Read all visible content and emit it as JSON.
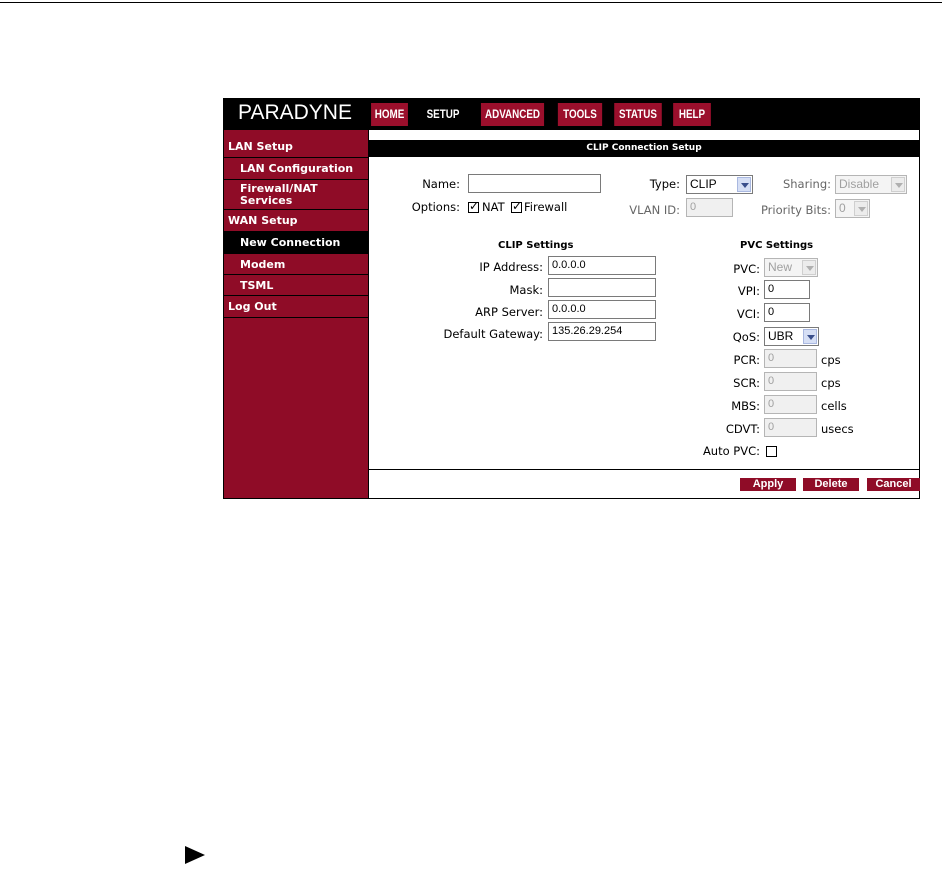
{
  "header": {
    "logo": "PARADYNE",
    "tabs": [
      "HOME",
      "SETUP",
      "ADVANCED",
      "TOOLS",
      "STATUS",
      "HELP"
    ],
    "active_tab": "SETUP"
  },
  "sidebar": {
    "items": [
      {
        "label": "LAN Setup"
      },
      {
        "label": "LAN Configuration"
      },
      {
        "label": "Firewall/NAT"
      },
      {
        "label": "Services"
      },
      {
        "label": "WAN Setup"
      },
      {
        "label": "New Connection"
      },
      {
        "label": "Modem"
      },
      {
        "label": "TSML"
      },
      {
        "label": "Log Out"
      }
    ]
  },
  "main": {
    "title": "CLIP Connection Setup",
    "name_label": "Name:",
    "name_value": "",
    "type_label": "Type:",
    "type_value": "CLIP",
    "sharing_label": "Sharing:",
    "sharing_value": "Disable",
    "options_label": "Options:",
    "nat_label": "NAT",
    "firewall_label": "Firewall",
    "vlan_label": "VLAN ID:",
    "vlan_value": "0",
    "priority_label": "Priority Bits:",
    "priority_value": "0",
    "clip": {
      "heading": "CLIP Settings",
      "ip_label": "IP Address:",
      "ip_value": "0.0.0.0",
      "mask_label": "Mask:",
      "mask_value": "",
      "arp_label": "ARP Server:",
      "arp_value": "0.0.0.0",
      "gw_label": "Default Gateway:",
      "gw_value": "135.26.29.254"
    },
    "pvc": {
      "heading": "PVC Settings",
      "pvc_label": "PVC:",
      "pvc_value": "New",
      "vpi_label": "VPI:",
      "vpi_value": "0",
      "vci_label": "VCI:",
      "vci_value": "0",
      "qos_label": "QoS:",
      "qos_value": "UBR",
      "pcr_label": "PCR:",
      "pcr_value": "0",
      "pcr_unit": "cps",
      "scr_label": "SCR:",
      "scr_value": "0",
      "scr_unit": "cps",
      "mbs_label": "MBS:",
      "mbs_value": "0",
      "mbs_unit": "cells",
      "cdvt_label": "CDVT:",
      "cdvt_value": "0",
      "cdvt_unit": "usecs",
      "auto_label": "Auto PVC:"
    },
    "buttons": {
      "apply": "Apply",
      "delete": "Delete",
      "cancel": "Cancel"
    }
  },
  "colors": {
    "brand_red": "#8f0c27",
    "black": "#000000"
  }
}
